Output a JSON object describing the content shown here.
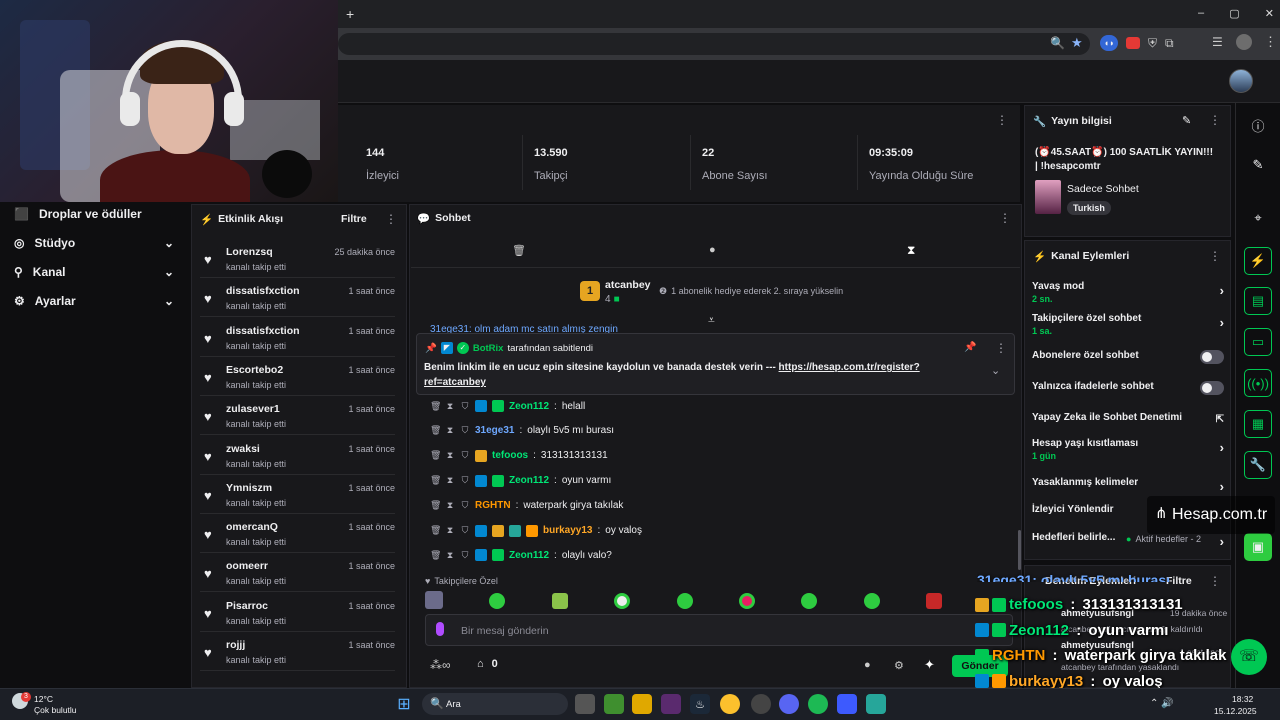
{
  "browser": {
    "new_tab": "+",
    "win_controls": [
      "–",
      "▢",
      "✕"
    ]
  },
  "sidebar": {
    "items": [
      {
        "label": "Droplar ve ödüller",
        "icon": "gift-icon",
        "chevron": false
      },
      {
        "label": "Stüdyo",
        "icon": "studio-icon",
        "chevron": true
      },
      {
        "label": "Kanal",
        "icon": "channel-icon",
        "chevron": true
      },
      {
        "label": "Ayarlar",
        "icon": "gear-icon",
        "chevron": true
      }
    ]
  },
  "stats": [
    {
      "value": "144",
      "label": "İzleyici"
    },
    {
      "value": "13.590",
      "label": "Takipçi"
    },
    {
      "value": "22",
      "label": "Abone Sayısı"
    },
    {
      "value": "09:35:09",
      "label": "Yayında Olduğu Süre"
    }
  ],
  "activity": {
    "title": "Etkinlik Akışı",
    "filter": "Filtre",
    "items": [
      {
        "name": "Lorenzsq",
        "action": "kanalı takip etti",
        "time": "25 dakika önce"
      },
      {
        "name": "dissatisfxction",
        "action": "kanalı takip etti",
        "time": "1 saat önce"
      },
      {
        "name": "dissatisfxction",
        "action": "kanalı takip etti",
        "time": "1 saat önce"
      },
      {
        "name": "Escortebo2",
        "action": "kanalı takip etti",
        "time": "1 saat önce"
      },
      {
        "name": "zulasever1",
        "action": "kanalı takip etti",
        "time": "1 saat önce"
      },
      {
        "name": "zwaksi",
        "action": "kanalı takip etti",
        "time": "1 saat önce"
      },
      {
        "name": "Ymniszm",
        "action": "kanalı takip etti",
        "time": "1 saat önce"
      },
      {
        "name": "omercanQ",
        "action": "kanalı takip etti",
        "time": "1 saat önce"
      },
      {
        "name": "oomeerr",
        "action": "kanalı takip etti",
        "time": "1 saat önce"
      },
      {
        "name": "Pisarroc",
        "action": "kanalı takip etti",
        "time": "1 saat önce"
      },
      {
        "name": "rojjj",
        "action": "kanalı takip etti",
        "time": "1 saat önce"
      }
    ]
  },
  "chat": {
    "title": "Sohbet",
    "leader": {
      "rank": "1",
      "name": "atcanbey",
      "count": "4",
      "hint": "1 abonelik hediye ederek 2. sıraya yükselin"
    },
    "partial_line": "31ege31: olm adam mc satın almış zengin",
    "pinned": {
      "by": "BotRix",
      "by_suffix": "tarafından sabitlendi",
      "text": "Benim linkim ile en ucuz epin sitesine kaydolun ve banada destek verin --- ",
      "link": "https://hesap.com.tr/register?ref=atcanbey"
    },
    "messages": [
      {
        "user": "Zeon112",
        "text": "helall",
        "color": "#00e676"
      },
      {
        "user": "31ege31",
        "text": "olaylı 5v5 mı burası",
        "color": "#6ea8ff"
      },
      {
        "user": "tefooos",
        "text": "313131313131",
        "color": "#00e676"
      },
      {
        "user": "Zeon112",
        "text": "oyun varmı",
        "color": "#00e676"
      },
      {
        "user": "RGHTN",
        "text": "waterpark girya takılak",
        "color": "#ff9800"
      },
      {
        "user": "burkayy13",
        "text": "oy valoş",
        "color": "#ffa726"
      },
      {
        "user": "Zeon112",
        "text": "olaylı valo?",
        "color": "#00e676"
      }
    ],
    "followers_only": "Takipçilere Özel",
    "input_placeholder": "Bir mesaj gönderin",
    "points": "0",
    "send": "Gönder"
  },
  "stream_info": {
    "title": "Yayın bilgisi",
    "stream_title": "(⏰45.SAAT⏰) 100 SAATLİK YAYIN!!! | !hesapcomtr",
    "category": "Sadece Sohbet",
    "tag": "Turkish"
  },
  "channel_actions": {
    "title": "Kanal Eylemleri",
    "rows": [
      {
        "label": "Yavaş mod",
        "sub": "2 sn.",
        "type": "arrow"
      },
      {
        "label": "Takipçilere özel sohbet",
        "sub": "1 sa.",
        "type": "arrow"
      },
      {
        "label": "Abonelere özel sohbet",
        "sub": "",
        "type": "toggle"
      },
      {
        "label": "Yalnızca ifadelerle sohbet",
        "sub": "",
        "type": "toggle"
      },
      {
        "label": "Yapay Zeka ile Sohbet Denetimi",
        "sub": "",
        "type": "external"
      },
      {
        "label": "Hesap yaşı kısıtlaması",
        "sub": "1 gün",
        "type": "arrow"
      },
      {
        "label": "Yasaklanmış kelimeler",
        "sub": "",
        "type": "arrow"
      },
      {
        "label": "İzleyici Yönlendir",
        "sub": "",
        "type": "none"
      },
      {
        "label": "Hedefleri belirle...",
        "sub": "",
        "type": "arrow"
      }
    ],
    "goals_status": "Aktif hedefler - 2"
  },
  "mod_log": {
    "title": "Denetim Eylemleri",
    "filter": "Filtre",
    "items": [
      {
        "user": "ahmetyusufsngl",
        "time": "19 dakika önce",
        "text": "atcanbey kullanıcının yasağı kaldırıldı"
      },
      {
        "user": "ahmetyusufsngl",
        "time": "1 saat önce",
        "text": "atcanbey tarafından yasaklandı"
      }
    ]
  },
  "overlay": {
    "watermark": "Hesap.com.tr",
    "partial": "31ege31: olaylı 5v5 mı burası",
    "lines": [
      {
        "user": "tefooos",
        "text": "313131313131",
        "color": "#00e676"
      },
      {
        "user": "Zeon112",
        "text": "oyun varmı",
        "color": "#00e676"
      },
      {
        "user": "RGHTN",
        "text": "waterpark girya takılak",
        "color": "#ff9800"
      },
      {
        "user": "burkayy13",
        "text": "oy valoş",
        "color": "#ffa726"
      },
      {
        "user": "Zeon112",
        "text": "olaylı valo?",
        "color": "#00e676"
      }
    ]
  },
  "taskbar": {
    "weather_temp": "12°C",
    "weather_desc": "Çok bulutlu",
    "weather_badge": "3",
    "search": "Ara",
    "time": "18:32",
    "date": "15.12.2025"
  },
  "colors": {
    "accent": "#00c853",
    "panel": "#18181b",
    "bg": "#0e0e10"
  }
}
